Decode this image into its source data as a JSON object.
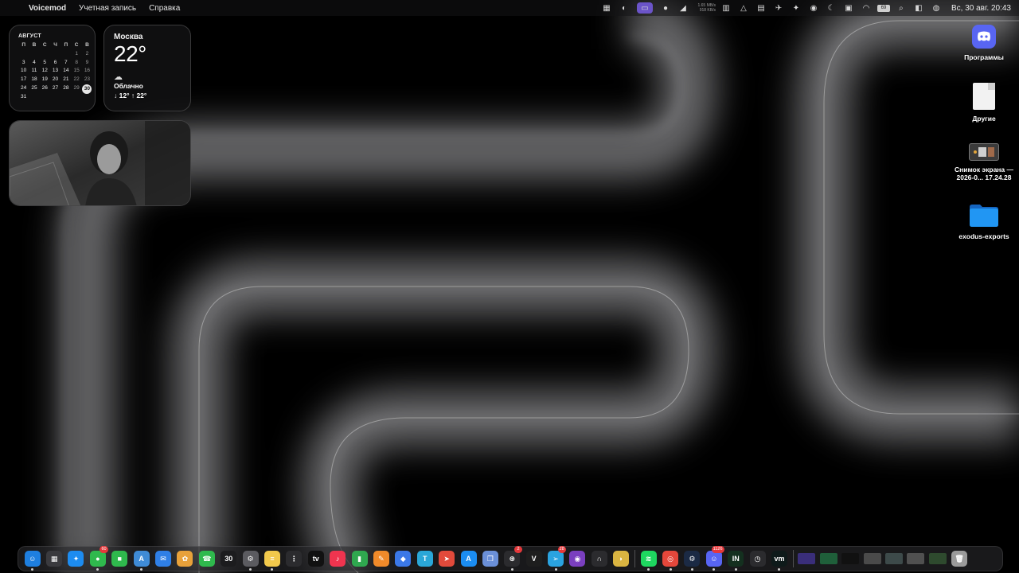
{
  "menubar": {
    "app_name": "Voicemod",
    "items": [
      "Учетная запись",
      "Справка"
    ],
    "net_up": "1.65 MB/s",
    "net_down": "918 KB/s",
    "battery": "69",
    "clock": "Вс, 30 авг.  20:43"
  },
  "calendar": {
    "month": "АВГУСТ",
    "weekdays": [
      "П",
      "В",
      "С",
      "Ч",
      "П",
      "С",
      "В"
    ],
    "weeks": [
      [
        "",
        "",
        "",
        "",
        "",
        "1",
        "2"
      ],
      [
        "3",
        "4",
        "5",
        "6",
        "7",
        "8",
        "9"
      ],
      [
        "10",
        "11",
        "12",
        "13",
        "14",
        "15",
        "16"
      ],
      [
        "17",
        "18",
        "19",
        "20",
        "21",
        "22",
        "23"
      ],
      [
        "24",
        "25",
        "26",
        "27",
        "28",
        "29",
        "30"
      ],
      [
        "31",
        "",
        "",
        "",
        "",
        "",
        ""
      ]
    ],
    "today": "30"
  },
  "weather": {
    "city": "Москва",
    "temp": "22°",
    "condition": "Облачно",
    "range": "↓ 12° ↑ 22°"
  },
  "desktop": {
    "items": [
      {
        "label": "Программы",
        "icon": "discord-icon"
      },
      {
        "label": "Другие",
        "icon": "document-icon"
      },
      {
        "label": "Снимок экрана —\n2026-0... 17.24.28",
        "label_l1": "Снимок экрана —",
        "label_l2": "2026-0... 17.24.28",
        "icon": "screenshot-thumbnail-icon"
      },
      {
        "label": "exodus-exports",
        "icon": "folder-icon"
      }
    ]
  },
  "dock": {
    "apps": [
      {
        "name": "finder",
        "color": "#1e7fe0",
        "glyph": "☺",
        "running": true
      },
      {
        "name": "launchpad",
        "color": "#3a3a3e",
        "glyph": "▦",
        "running": false
      },
      {
        "name": "safari",
        "color": "#1d8cf0",
        "glyph": "✦",
        "running": false
      },
      {
        "name": "messages",
        "color": "#2fb94d",
        "glyph": "●",
        "running": true,
        "badge": "60"
      },
      {
        "name": "facetime",
        "color": "#2fb94d",
        "glyph": "■",
        "running": false
      },
      {
        "name": "xcode",
        "color": "#3f8bd6",
        "glyph": "A",
        "running": true
      },
      {
        "name": "mail",
        "color": "#2f7fe6",
        "glyph": "✉",
        "running": false
      },
      {
        "name": "photos",
        "color": "#e8a13a",
        "glyph": "✿",
        "running": false
      },
      {
        "name": "phone",
        "color": "#2fb94d",
        "glyph": "☎",
        "running": false
      },
      {
        "name": "calendar",
        "color": "#1c1c1e",
        "glyph": "30",
        "running": false
      },
      {
        "name": "settings",
        "color": "#5b5b60",
        "glyph": "⚙",
        "running": true
      },
      {
        "name": "notes",
        "color": "#f2c94c",
        "glyph": "≡",
        "running": true
      },
      {
        "name": "reminders",
        "color": "#2b2b2e",
        "glyph": "⋮",
        "running": false
      },
      {
        "name": "apple-tv",
        "color": "#111111",
        "glyph": "tv",
        "running": false
      },
      {
        "name": "music",
        "color": "#f0344f",
        "glyph": "♪",
        "running": false
      },
      {
        "name": "numbers",
        "color": "#2fa84f",
        "glyph": "▮",
        "running": false
      },
      {
        "name": "pages",
        "color": "#f08a2a",
        "glyph": "✎",
        "running": false
      },
      {
        "name": "keynote",
        "color": "#3b78e7",
        "glyph": "◆",
        "running": false
      },
      {
        "name": "typora",
        "color": "#2aa7d8",
        "glyph": "T",
        "running": false
      },
      {
        "name": "rocket",
        "color": "#e24a3b",
        "glyph": "➤",
        "running": false
      },
      {
        "name": "app-store",
        "color": "#1b8df2",
        "glyph": "A",
        "running": false
      },
      {
        "name": "preview",
        "color": "#6a8fd8",
        "glyph": "❐",
        "running": false
      },
      {
        "name": "chatgpt",
        "color": "#2b2b2e",
        "glyph": "⊛",
        "running": true,
        "badge": "2"
      },
      {
        "name": "vim",
        "color": "#1e1e1e",
        "glyph": "V",
        "running": false
      },
      {
        "name": "telegram",
        "color": "#2aa3e0",
        "glyph": "➢",
        "running": true,
        "badge": "28"
      },
      {
        "name": "tor",
        "color": "#7a3fbf",
        "glyph": "◉",
        "running": false
      },
      {
        "name": "headphones",
        "color": "#2b2b2e",
        "glyph": "∩",
        "running": false
      },
      {
        "name": "cyberduck",
        "color": "#d9b441",
        "glyph": "◗",
        "running": false
      },
      {
        "sep": true
      },
      {
        "name": "spotify",
        "color": "#1ed760",
        "glyph": "≋",
        "running": true
      },
      {
        "name": "chrome",
        "color": "#e4473b",
        "glyph": "◎",
        "running": true
      },
      {
        "name": "steam",
        "color": "#1b2a44",
        "glyph": "⚙",
        "running": true
      },
      {
        "name": "discord",
        "color": "#5865f2",
        "glyph": "☺",
        "running": true,
        "badge": "1126"
      },
      {
        "name": "incy",
        "color": "#14301f",
        "glyph": "IN",
        "running": true
      },
      {
        "name": "clock-vpn",
        "color": "#2b2b2e",
        "glyph": "◷",
        "running": false
      },
      {
        "name": "voicemod",
        "color": "#0e1a1a",
        "glyph": "vm",
        "running": true
      },
      {
        "sep": true
      },
      {
        "name": "window-1",
        "color": "#3a2e7a",
        "glyph": "",
        "running": false
      },
      {
        "name": "window-2",
        "color": "#1f5f3a",
        "glyph": "",
        "running": false
      },
      {
        "name": "window-3",
        "color": "#111111",
        "glyph": "",
        "running": false
      },
      {
        "name": "window-4",
        "color": "#4a4a4a",
        "glyph": "",
        "running": false
      },
      {
        "name": "window-5",
        "color": "#3d4a4a",
        "glyph": "",
        "running": false
      },
      {
        "name": "window-6",
        "color": "#505050",
        "glyph": "",
        "running": false
      },
      {
        "name": "window-7",
        "color": "#2e4a2e",
        "glyph": "",
        "running": false
      },
      {
        "name": "trash",
        "color": "#9a9a9a",
        "glyph": "🗑",
        "running": false
      }
    ]
  },
  "colors": {
    "accent": "#6b54c9",
    "discord": "#5865f2",
    "folder": "#1e88e5"
  }
}
